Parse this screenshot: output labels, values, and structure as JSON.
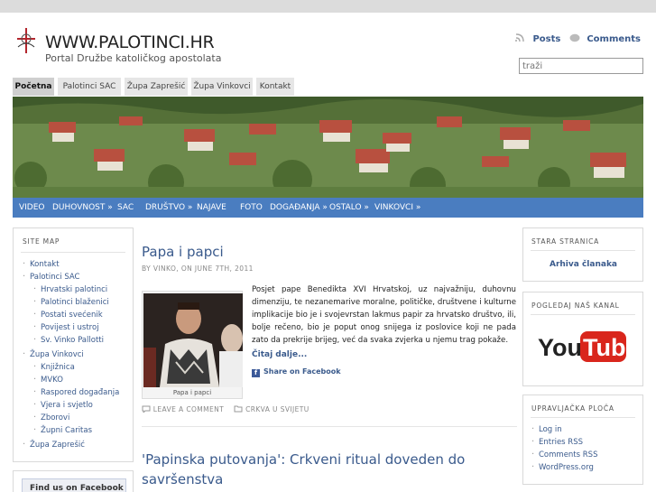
{
  "site": {
    "title": "WWW.PALOTINCI.HR",
    "subtitle": "Portal Družbe katoličkog apostolata",
    "feeds": {
      "posts": "Posts",
      "comments": "Comments"
    },
    "search_placeholder": "traži"
  },
  "tabs": [
    "Početna",
    "Palotinci SAC",
    "Župa Zaprešić",
    "Župa Vinkovci",
    "Kontakt"
  ],
  "nav": [
    "VIDEO",
    "DUHOVNOST »",
    "SAC",
    "DRUŠTVO »",
    "NAJAVE",
    "FOTO",
    "DOGAĐANJA »",
    "OSTALO »",
    "VINKOVCI »"
  ],
  "sitemap": {
    "heading": "SITE MAP",
    "items": [
      "Kontakt",
      "Palotinci SAC",
      "Hrvatski palotinci",
      "Palotinci blaženici",
      "Postati svećenik",
      "Povijest i ustroj",
      "Sv. Vinko Pallotti",
      "Župa Vinkovci",
      "Knjižnica",
      "MVKO",
      "Raspored događanja",
      "Vjera i svjetlo",
      "Zborovi",
      "Župni Caritas",
      "Župa Zaprešić"
    ]
  },
  "facebook_box": {
    "label": "Find us on Facebook"
  },
  "post1": {
    "title": "Papa i papci",
    "meta": "BY VINKO, ON JUNE 7TH, 2011",
    "image_caption": "Papa i papci",
    "body": "Posjet pape Benedikta XVI Hrvatskoj, uz najvažniju, duhovnu dimenziju, te nezanemarive moralne, političke, društvene i kulturne implikacije bio je i svojevrstan lakmus papir za hrvatsko društvo, ili, bolje rečeno, bio je poput onog snijega iz poslovice koji ne pada zato da prekrije brijeg, već da svaka zvjerka u njemu trag pokaže.",
    "read_more": "Čitaj dalje...",
    "share": "Share on Facebook",
    "comment": "LEAVE A COMMENT",
    "category": "CRKVA U SVIJETU"
  },
  "post2": {
    "title": "'Papinska putovanja': Crkveni ritual doveden do savršenstva"
  },
  "right": {
    "old_heading": "STARA STRANICA",
    "old_link": "Arhiva članaka",
    "channel_heading": "POGLEDAJ NAŠ KANAL",
    "youtube": {
      "you": "You",
      "tube": "Tube"
    },
    "admin_heading": "UPRAVLJAČKA PLOČA",
    "admin_items": [
      "Log in",
      "Entries RSS",
      "Comments RSS",
      "WordPress.org"
    ]
  }
}
